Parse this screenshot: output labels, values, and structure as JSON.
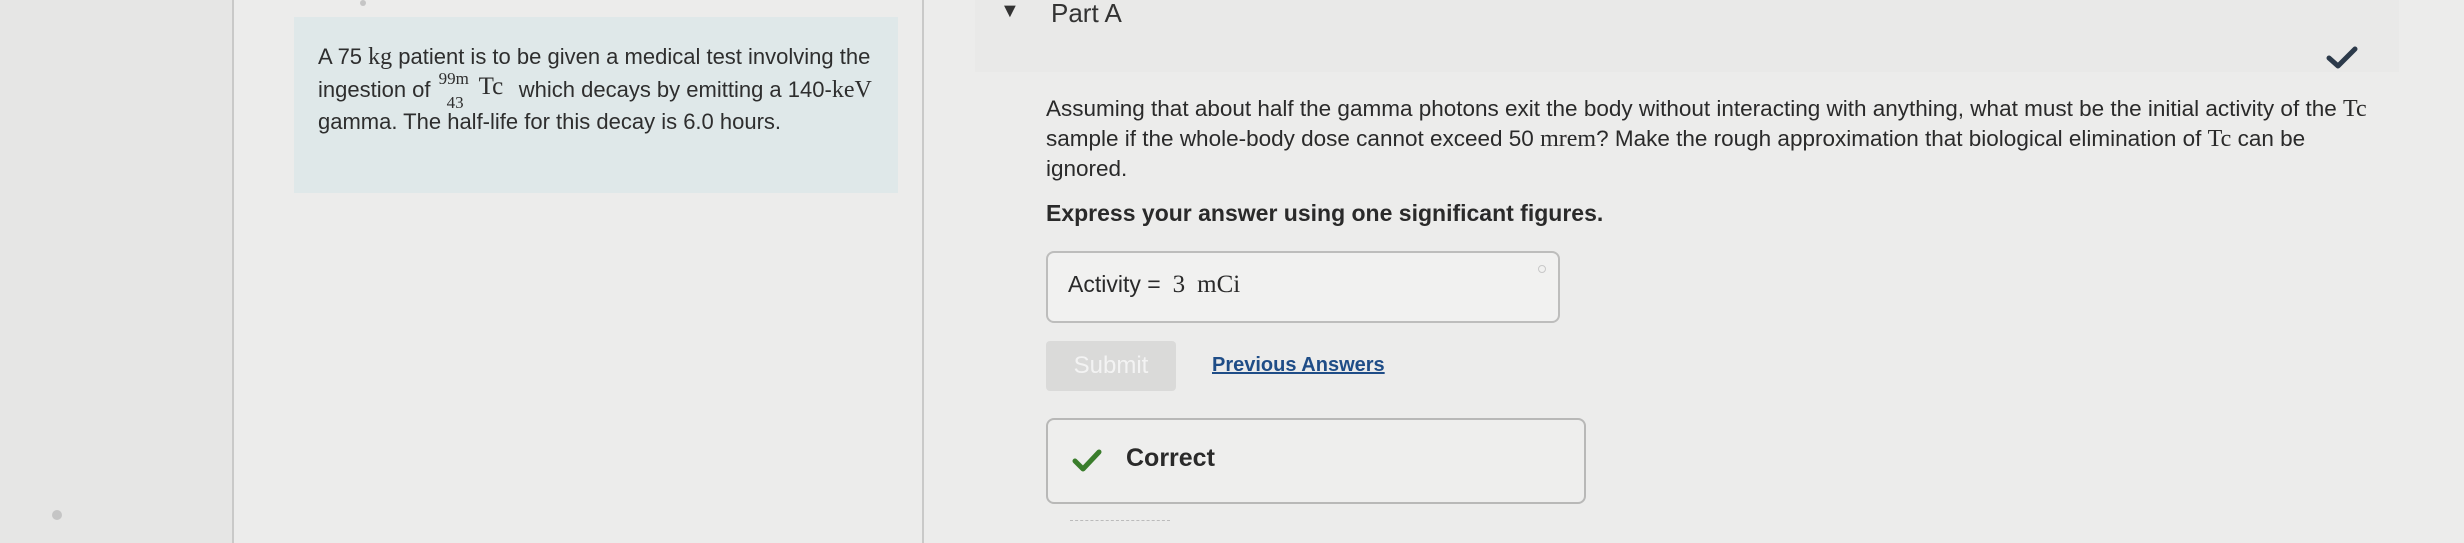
{
  "problem": {
    "pre_mass": "A 75 ",
    "mass_unit": "kg",
    "mid": " patient is to be given a medical test involving the ingestion of ",
    "iso_sup": "99m",
    "iso_sub": "43",
    "iso_sym": "Tc",
    "post": " which decays by emitting a 140-",
    "energy_unit": "keV",
    "tail": " gamma. The half-life for this decay is 6.0 hours."
  },
  "part": {
    "title": "Part A"
  },
  "question": {
    "text1": "Assuming that about half the gamma photons exit the body without interacting with anything, what must be the initial activity of the ",
    "tc1": "Tc",
    "text2": " sample if the whole-body dose cannot exceed 50 ",
    "dose_unit": "mrem",
    "text3": "? Make the rough approximation that biological elimination of ",
    "tc2": "Tc",
    "text4": " can be ignored."
  },
  "instruction": "Express your answer using one significant figures.",
  "answer": {
    "label": "Activity =",
    "value": "3",
    "unit": "mCi"
  },
  "buttons": {
    "submit": "Submit",
    "previous_answers": "Previous Answers"
  },
  "feedback": {
    "status": "Correct"
  },
  "colors": {
    "correct_green": "#3a7d2c",
    "link_blue": "#1f4d87",
    "problem_bg": "#dfe8e9"
  }
}
